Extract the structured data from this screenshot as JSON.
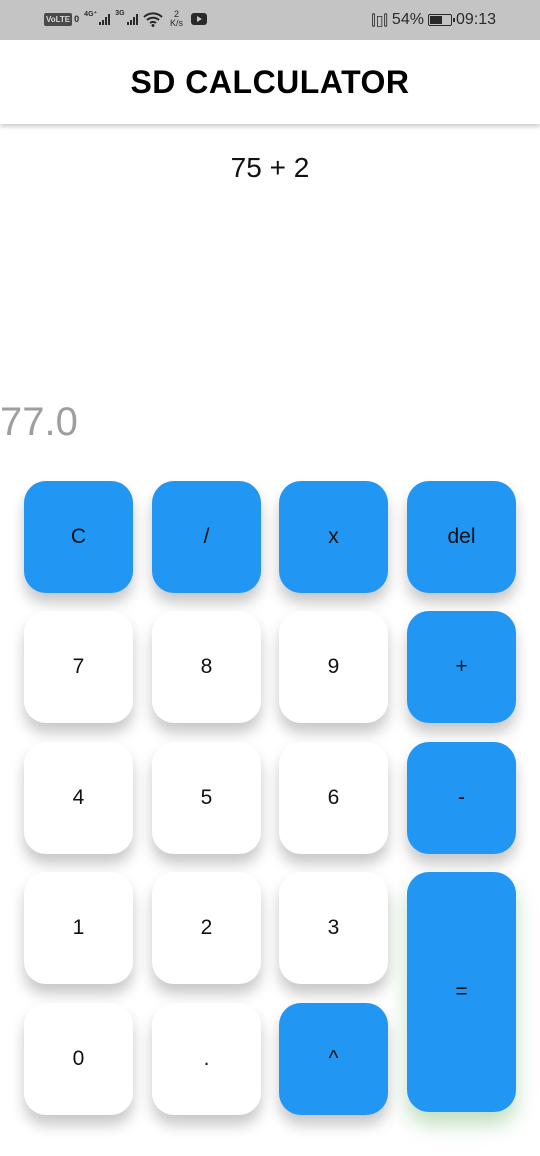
{
  "status_bar": {
    "volte": "VoLTE",
    "sim": "0",
    "net1": "4G⁺",
    "net2": "3G",
    "speed_value": "2",
    "speed_unit": "K/s",
    "battery_percent": "54%",
    "battery_level": 0.54,
    "time": "09:13"
  },
  "app": {
    "title": "SD CALCULATOR"
  },
  "display": {
    "expression": "75 + 2",
    "result": "77.0"
  },
  "keys": {
    "clear": "C",
    "divide": "/",
    "multiply": "x",
    "delete": "del",
    "seven": "7",
    "eight": "8",
    "nine": "9",
    "plus": "+",
    "four": "4",
    "five": "5",
    "six": "6",
    "minus": "-",
    "one": "1",
    "two": "2",
    "three": "3",
    "equals": "=",
    "zero": "0",
    "dot": ".",
    "power": "^"
  },
  "colors": {
    "accent": "#2196f3",
    "status_bar": "#c4c4c4",
    "result_text": "#9e9e9e"
  }
}
